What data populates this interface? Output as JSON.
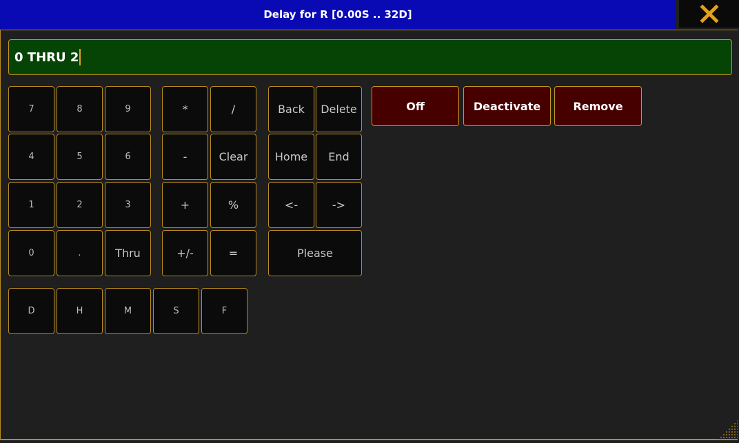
{
  "window": {
    "title": "Delay for R [0.00S .. 32D]",
    "close_icon": "x-icon",
    "accent_color": "#e0a21e",
    "title_bg": "#0a0ab4"
  },
  "input": {
    "value": "0 THRU 2"
  },
  "numpad": {
    "k7": "7",
    "k8": "8",
    "k9": "9",
    "k4": "4",
    "k5": "5",
    "k6": "6",
    "k1": "1",
    "k2": "2",
    "k3": "3",
    "k0": "0",
    "dot": ".",
    "thru": "Thru"
  },
  "operators": {
    "multiply": "*",
    "divide": "/",
    "minus": "-",
    "clear": "Clear",
    "plus": "+",
    "percent": "%",
    "plusminus": "+/-",
    "equals": "="
  },
  "editing": {
    "back": "Back",
    "delete": "Delete",
    "home": "Home",
    "end": "End",
    "left": "<-",
    "right": "->",
    "please": "Please"
  },
  "units": {
    "days": "D",
    "hours": "H",
    "minutes": "M",
    "seconds": "S",
    "frames": "F"
  },
  "actions": {
    "off": "Off",
    "deactivate": "Deactivate",
    "remove": "Remove"
  }
}
